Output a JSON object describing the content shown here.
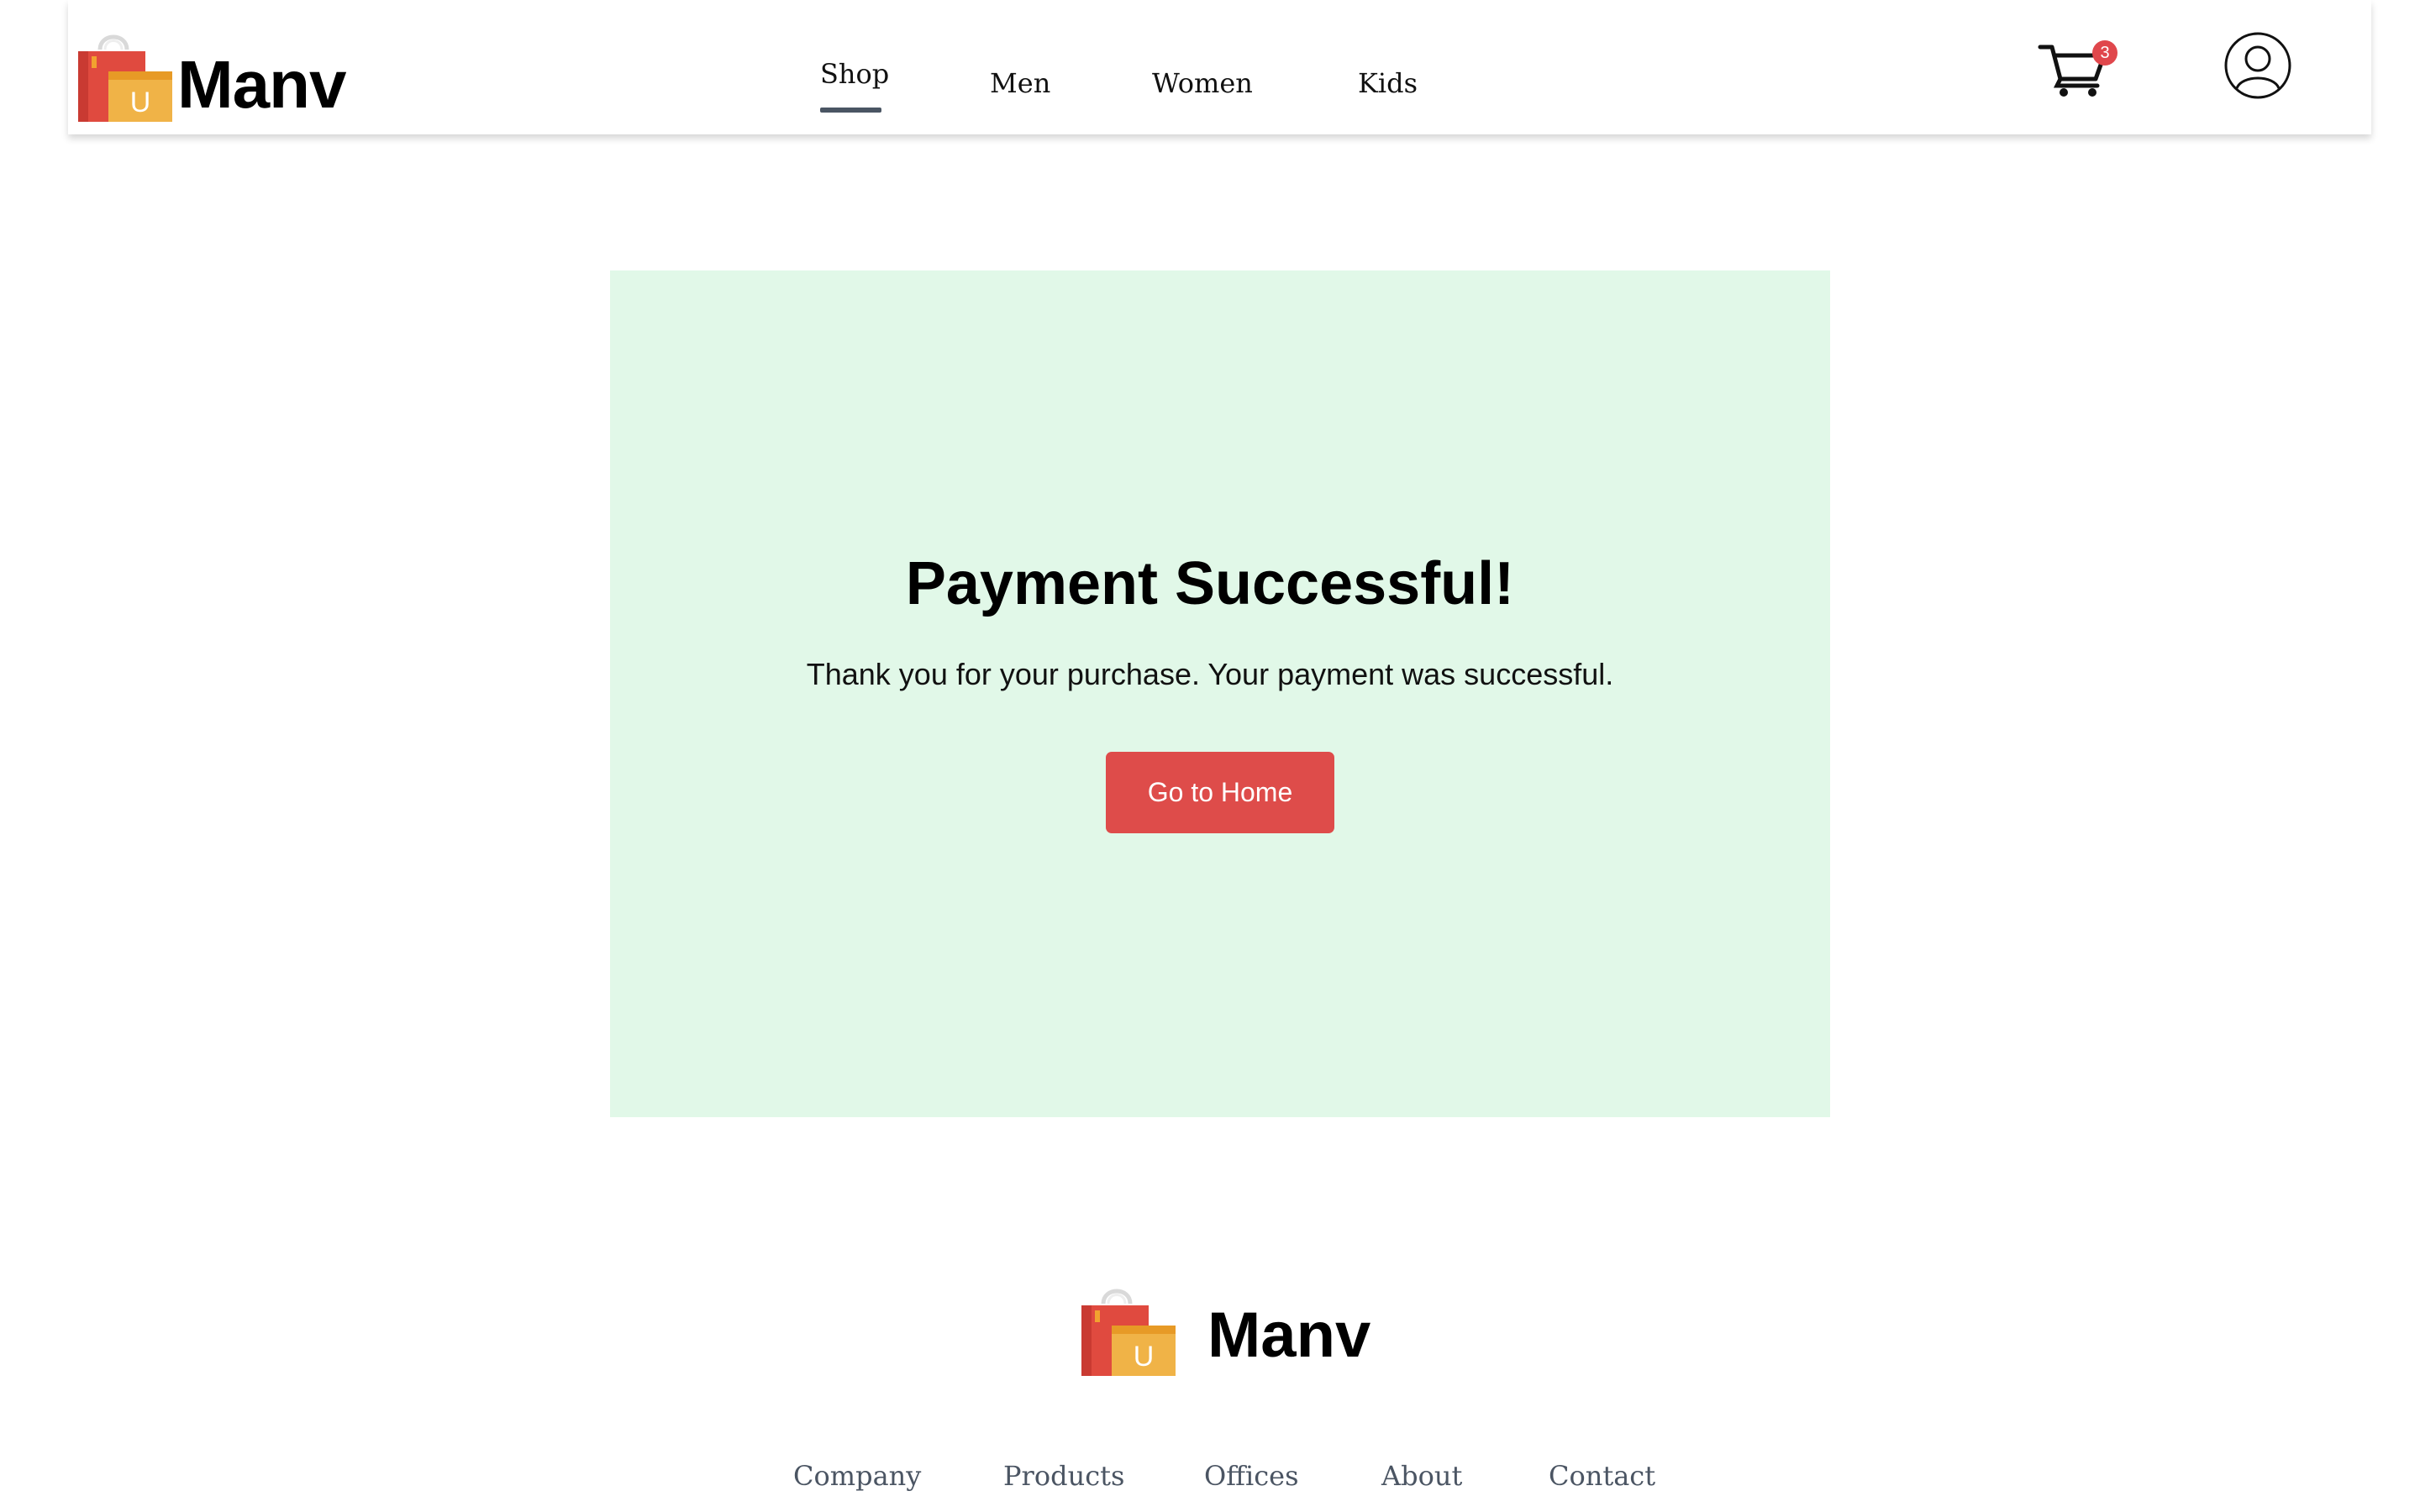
{
  "header": {
    "brand_name": "Manv",
    "logo_icon": "shopping-bags-icon",
    "nav": [
      {
        "label": "Shop",
        "active": true
      },
      {
        "label": "Men",
        "active": false
      },
      {
        "label": "Women",
        "active": false
      },
      {
        "label": "Kids",
        "active": false
      }
    ],
    "cart_count": "3",
    "cart_icon": "cart-icon",
    "user_icon": "user-icon"
  },
  "main": {
    "title": "Payment Successful!",
    "message": "Thank you for your purchase. Your payment was successful.",
    "button_label": "Go to Home"
  },
  "footer": {
    "brand_name": "Manv",
    "links": [
      "Company",
      "Products",
      "Offices",
      "About",
      "Contact"
    ]
  },
  "colors": {
    "accent": "#de4c4a",
    "panel_background": "#e1f8e8",
    "badge": "#e0474c",
    "nav_underline": "#4a5563"
  }
}
